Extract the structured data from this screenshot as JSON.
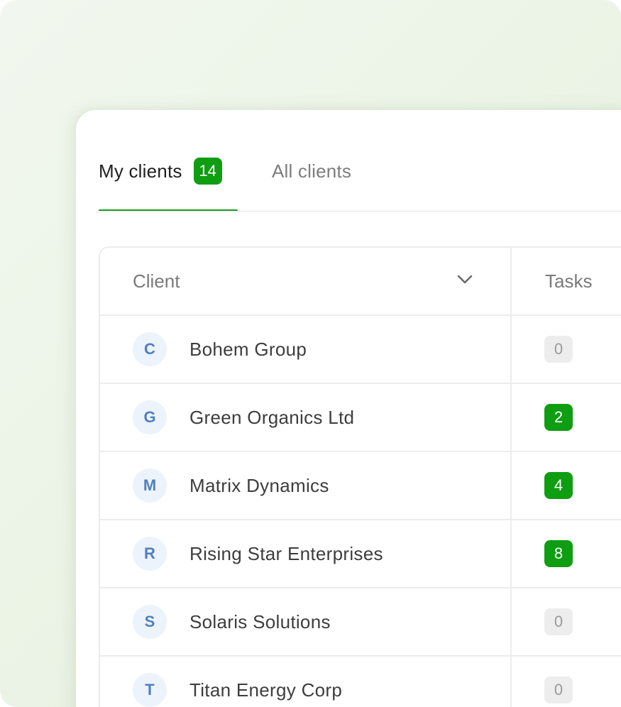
{
  "colors": {
    "accent": "#0f9d12",
    "avatar_bg": "#edf3fb",
    "avatar_text": "#4f7fc0",
    "zero_badge_bg": "#ededed"
  },
  "tabs": [
    {
      "label": "My clients",
      "count": "14",
      "active": true
    },
    {
      "label": "All clients",
      "active": false
    }
  ],
  "table": {
    "columns": {
      "client": "Client",
      "client_sort_icon": "chevron-down-icon",
      "tasks": "Tasks"
    },
    "rows": [
      {
        "initial": "C",
        "name": "Bohem Group",
        "tasks": "0"
      },
      {
        "initial": "G",
        "name": "Green Organics Ltd",
        "tasks": "2"
      },
      {
        "initial": "M",
        "name": "Matrix Dynamics",
        "tasks": "4"
      },
      {
        "initial": "R",
        "name": "Rising Star Enterprises",
        "tasks": "8"
      },
      {
        "initial": "S",
        "name": "Solaris Solutions",
        "tasks": "0"
      },
      {
        "initial": "T",
        "name": "Titan Energy Corp",
        "tasks": "0"
      }
    ]
  }
}
